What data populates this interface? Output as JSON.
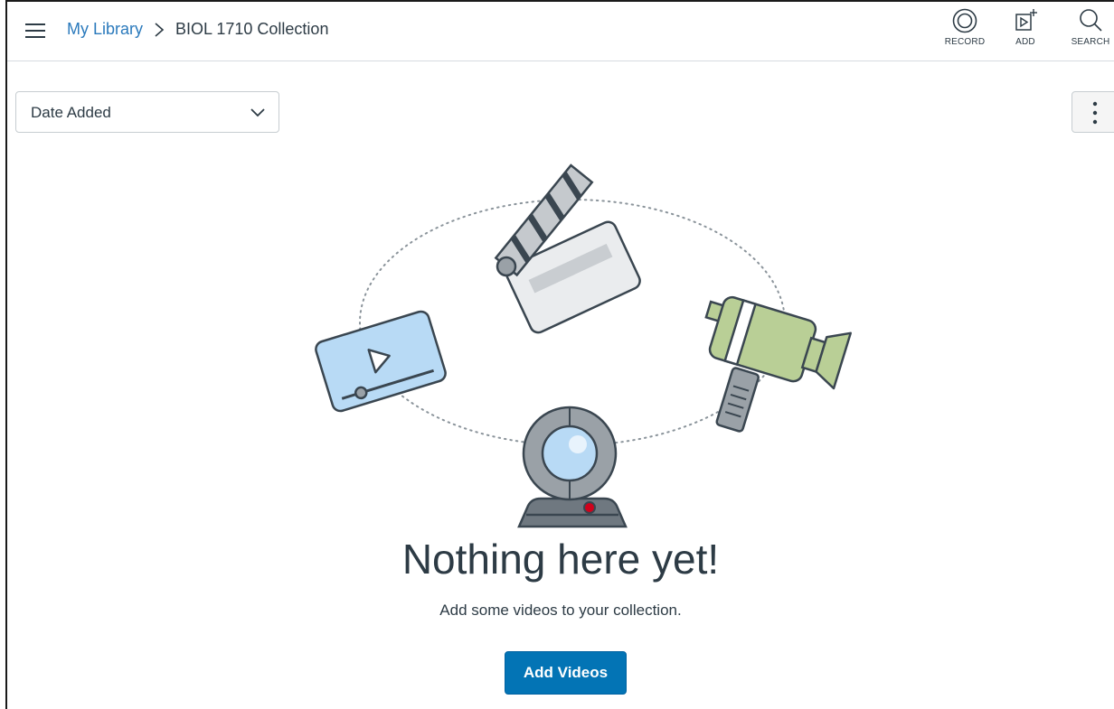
{
  "breadcrumb": {
    "parent": "My Library",
    "current": "BIOL 1710 Collection"
  },
  "toolbar": {
    "record_label": "RECORD",
    "add_label": "ADD",
    "search_label": "SEARCH"
  },
  "sort": {
    "selected": "Date Added"
  },
  "empty_state": {
    "title": "Nothing here yet!",
    "subtitle": "Add some videos to your collection.",
    "button_label": "Add Videos"
  },
  "colors": {
    "link": "#2b7abc",
    "primary_button": "#0374b5",
    "text": "#2d3b45"
  }
}
